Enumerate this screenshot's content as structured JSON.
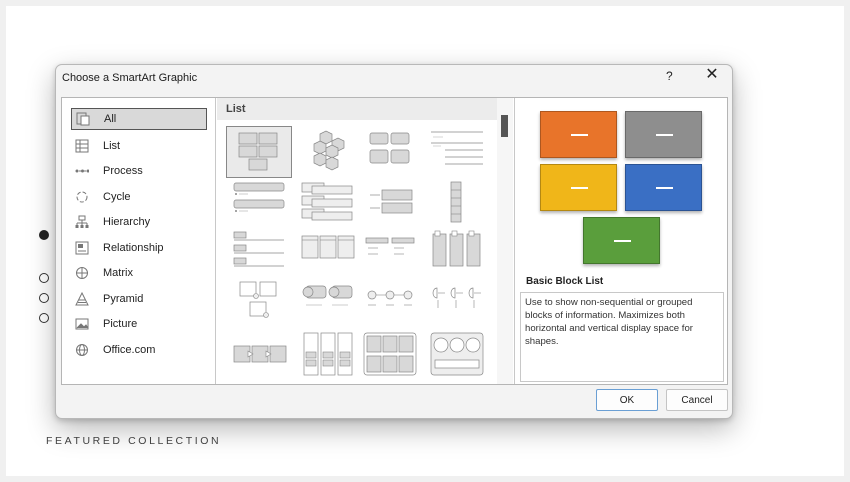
{
  "page": {
    "featured_label": "FEATURED COLLECTION"
  },
  "dialog": {
    "title": "Choose a SmartArt Graphic",
    "help_label": "?",
    "close_label": "✕",
    "categories": [
      {
        "label": "All",
        "icon": "all-icon",
        "selected": true
      },
      {
        "label": "List",
        "icon": "list-icon"
      },
      {
        "label": "Process",
        "icon": "process-icon"
      },
      {
        "label": "Cycle",
        "icon": "cycle-icon"
      },
      {
        "label": "Hierarchy",
        "icon": "hierarchy-icon"
      },
      {
        "label": "Relationship",
        "icon": "relationship-icon"
      },
      {
        "label": "Matrix",
        "icon": "matrix-icon"
      },
      {
        "label": "Pyramid",
        "icon": "pyramid-icon"
      },
      {
        "label": "Picture",
        "icon": "picture-icon"
      },
      {
        "label": "Office.com",
        "icon": "globe-icon"
      }
    ],
    "gallery_heading": "List",
    "preview": {
      "title": "Basic Block List",
      "description": "Use to show non-sequential or grouped blocks of information. Maximizes both horizontal and vertical display space for shapes.",
      "colors": [
        "#e8742a",
        "#8e8e8e",
        "#f0b619",
        "#3a6fc4",
        "#5a9e3c"
      ]
    },
    "ok_label": "OK",
    "cancel_label": "Cancel"
  }
}
